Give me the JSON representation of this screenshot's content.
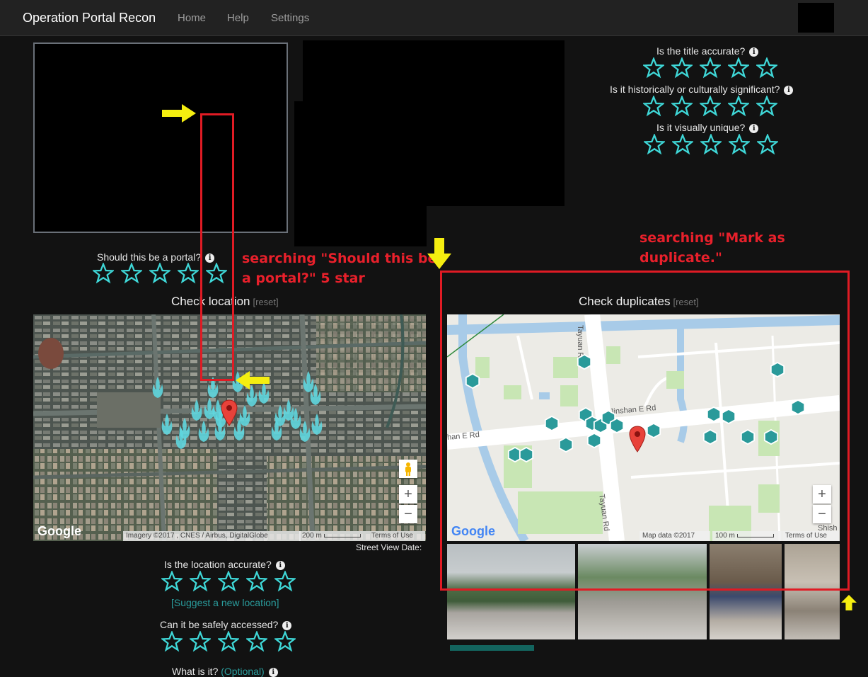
{
  "nav": {
    "brand": "Operation Portal Recon",
    "links": [
      "Home",
      "Help",
      "Settings"
    ]
  },
  "questions": {
    "title_accurate": "Is the title accurate?",
    "significant": "Is it historically or culturally significant?",
    "unique": "Is it visually unique?",
    "should_be_portal": "Should this be a portal?",
    "location_accurate": "Is the location accurate?",
    "safe_access": "Can it be safely accessed?",
    "what_is_it": "What is it?",
    "optional": "(Optional)"
  },
  "check_location": {
    "title": "Check location",
    "reset": "[reset]",
    "street_view_label": "Street View Date:",
    "suggest": "[Suggest a new location]"
  },
  "check_duplicates": {
    "title": "Check duplicates",
    "reset": "[reset]"
  },
  "map_location": {
    "logo": "Google",
    "imagery": "Imagery ©2017 , CNES / Airbus, DigitalGlobe",
    "scale": "200 m",
    "terms": "Terms of Use",
    "zoom_in": "+",
    "zoom_out": "−"
  },
  "map_duplicates": {
    "logo": "Google",
    "mapdata": "Map data ©2017",
    "scale": "100 m",
    "terms": "Terms of Use",
    "zoom_in": "+",
    "zoom_out": "−",
    "streets": {
      "tayuan_top": "Tayuan Rd",
      "tayuan_bottom": "Tayuan Rd",
      "jinshan_right": "Jinshan E Rd",
      "jinshan_left": "han E Rd",
      "shish": "Shish"
    }
  },
  "annotations": {
    "portal_line1": "searching \"Should this be",
    "portal_line2": "a portal?\" 5 star",
    "dup_line1": "searching \"Mark as",
    "dup_line2": "duplicate.\""
  },
  "colors": {
    "star": "#3fd8d8",
    "annotation": "#e8202b",
    "arrow": "#f5ee10",
    "portal_marker": "#2a9a9a"
  },
  "icons": {
    "star": "star-outline-icon",
    "info": "info-circle-icon",
    "pegman": "pegman-icon",
    "map_pin": "map-pin-icon"
  }
}
